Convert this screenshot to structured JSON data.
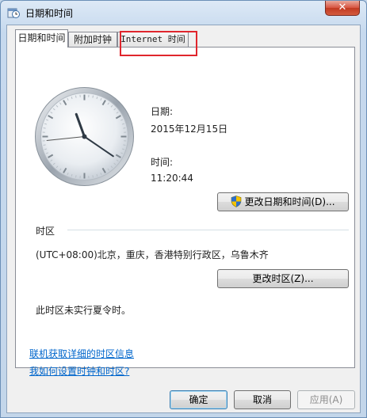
{
  "window": {
    "title": "日期和时间",
    "close_label": "✕"
  },
  "tabs": [
    {
      "label": "日期和时间"
    },
    {
      "label": "附加时钟"
    },
    {
      "label": "Internet 时间"
    }
  ],
  "datetime": {
    "date_label": "日期:",
    "date_value": "2015年12月15日",
    "time_label": "时间:",
    "time_value": "11:20:44",
    "change_button": "更改日期和时间(D)..."
  },
  "timezone": {
    "section_label": "时区",
    "value": "(UTC+08:00)北京，重庆，香港特别行政区，乌鲁木齐",
    "change_button": "更改时区(Z)...",
    "dst_note": "此时区未实行夏令时。"
  },
  "links": {
    "online_info": "联机获取详细的时区信息",
    "how_to": "我如何设置时钟和时区?"
  },
  "footer": {
    "ok": "确定",
    "cancel": "取消",
    "apply": "应用(A)"
  },
  "clock": {
    "hour": 11,
    "minute": 20,
    "second": 44
  },
  "icons": {
    "title": "datetime-icon",
    "shield": "uac-shield-icon"
  }
}
